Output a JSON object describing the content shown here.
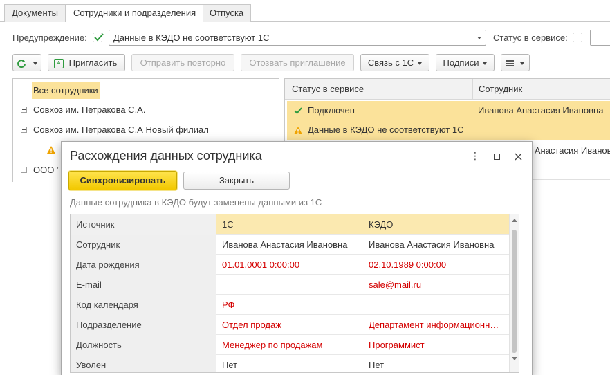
{
  "tabs": [
    "Документы",
    "Сотрудники и подразделения",
    "Отпуска"
  ],
  "filter": {
    "warning_label": "Предупреждение:",
    "warning_value": "Данные в КЭДО не соответствуют 1С",
    "status_label": "Статус в сервисе:"
  },
  "toolbar": {
    "invite": "Пригласить",
    "resend": "Отправить повторно",
    "revoke": "Отозвать приглашение",
    "link": "Связь с 1С",
    "sign": "Подписи"
  },
  "tree": {
    "root": "Все сотрудники",
    "items": [
      "Совхоз им. Петракова С.А.",
      "Совхоз им. Петракова С.А Новый филиал",
      "ООО \""
    ]
  },
  "grid": {
    "headers": [
      "Статус в сервисе",
      "Сотрудник"
    ],
    "row1_status1": "Подключен",
    "row1_status2": "Данные в КЭДО не соответствуют 1С",
    "row1_employee": "Иванова Анастасия Ивановна",
    "row2_employee_partial": "а Анастасия Ивановна"
  },
  "modal": {
    "title": "Расхождения данных сотрудника",
    "sync": "Синхронизировать",
    "close": "Закрыть",
    "note": "Данные сотрудника в КЭДО будут заменены данными из 1С",
    "header": [
      "Источник",
      "1С",
      "КЭДО"
    ],
    "rows": [
      {
        "field": "Сотрудник",
        "c1": "Иванова Анастасия Ивановна",
        "c2": "Иванова Анастасия Ивановна"
      },
      {
        "field": "Дата рождения",
        "c1": "01.01.0001 0:00:00",
        "c2": "02.10.1989 0:00:00"
      },
      {
        "field": "E-mail",
        "c1": "",
        "c2": "sale@mail.ru"
      },
      {
        "field": "Код календаря",
        "c1": "РФ",
        "c2": ""
      },
      {
        "field": "Подразделение",
        "c1": "Отдел продаж",
        "c2": "Департамент информационных технологий"
      },
      {
        "field": "Должность",
        "c1": "Менеджер по продажам",
        "c2": "Программист"
      },
      {
        "field": "Уволен",
        "c1": "Нет",
        "c2": "Нет"
      }
    ]
  },
  "colors": {
    "accent_yellow": "#f2c800",
    "selection": "#fbe29a",
    "mismatch": "#d40000",
    "check_green": "#2e9b3e",
    "warning": "#f0a400"
  }
}
